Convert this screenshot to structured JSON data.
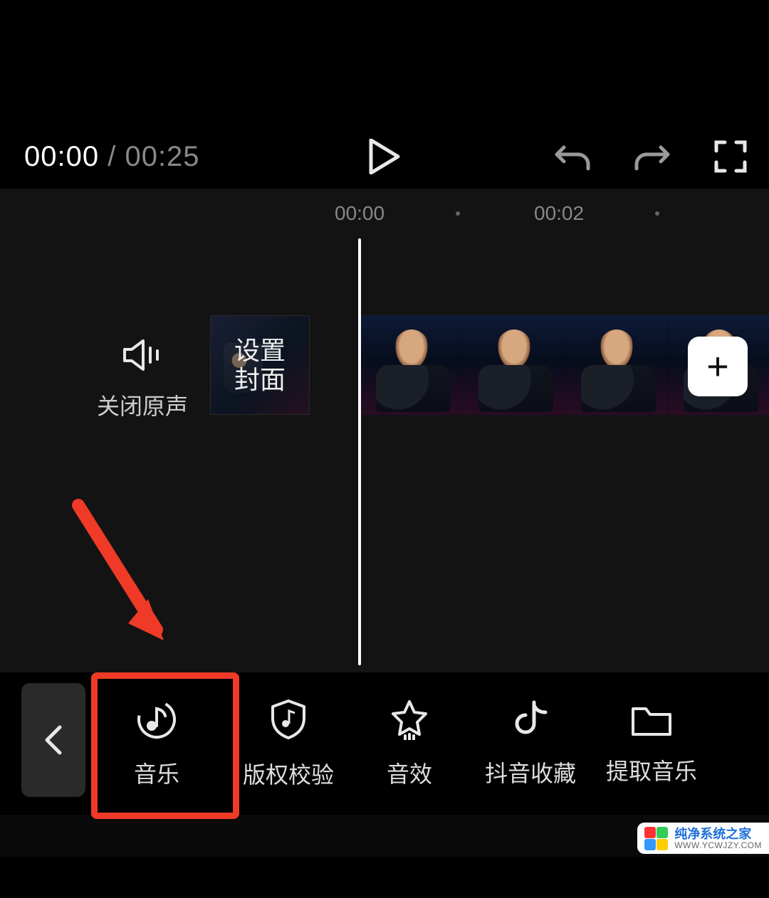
{
  "player": {
    "current_time": "00:00",
    "separator": " / ",
    "duration": "00:25"
  },
  "ruler": {
    "t0": "00:00",
    "t1": "00:02"
  },
  "timeline": {
    "mute_label": "关闭原声",
    "cover_label": "设置\n封面",
    "add_label": "+"
  },
  "tools": {
    "music": "音乐",
    "copyright": "版权校验",
    "sfx": "音效",
    "douyin_fav": "抖音收藏",
    "extract": "提取音乐"
  },
  "watermark": {
    "line1": "纯净系统之家",
    "line2": "WWW.YCWJZY.COM"
  }
}
